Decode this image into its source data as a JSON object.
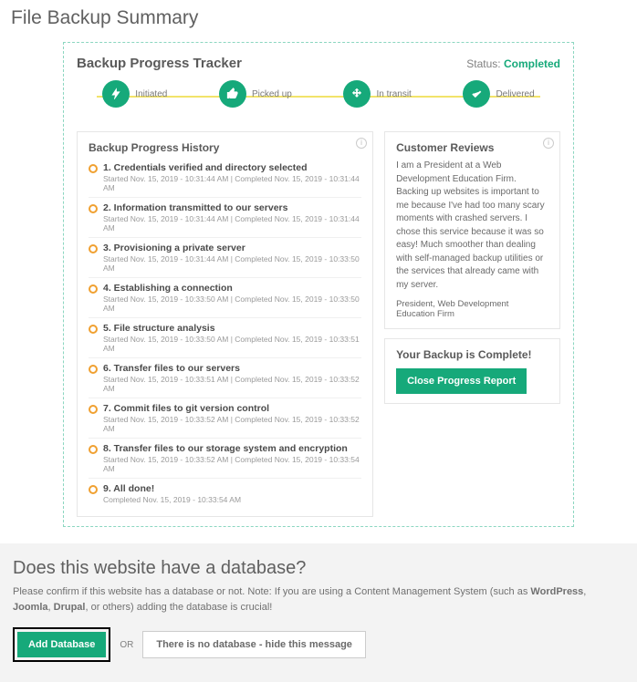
{
  "pageTitle": "File Backup Summary",
  "card": {
    "title": "Backup Progress Tracker",
    "statusLabel": "Status:",
    "statusValue": "Completed"
  },
  "tracker": [
    {
      "label": "Initiated"
    },
    {
      "label": "Picked up"
    },
    {
      "label": "In transit"
    },
    {
      "label": "Delivered"
    }
  ],
  "history": {
    "title": "Backup Progress History",
    "items": [
      {
        "title": "1. Credentials verified and directory selected",
        "started": "Started Nov. 15, 2019 - 10:31:44 AM",
        "completed": "Completed Nov. 15, 2019 - 10:31:44 AM"
      },
      {
        "title": "2. Information transmitted to our servers",
        "started": "Started Nov. 15, 2019 - 10:31:44 AM",
        "completed": "Completed Nov. 15, 2019 - 10:31:44 AM"
      },
      {
        "title": "3. Provisioning a private server",
        "started": "Started Nov. 15, 2019 - 10:31:44 AM",
        "completed": "Completed Nov. 15, 2019 - 10:33:50 AM"
      },
      {
        "title": "4. Establishing a connection",
        "started": "Started Nov. 15, 2019 - 10:33:50 AM",
        "completed": "Completed Nov. 15, 2019 - 10:33:50 AM"
      },
      {
        "title": "5. File structure analysis",
        "started": "Started Nov. 15, 2019 - 10:33:50 AM",
        "completed": "Completed Nov. 15, 2019 - 10:33:51 AM"
      },
      {
        "title": "6. Transfer files to our servers",
        "started": "Started Nov. 15, 2019 - 10:33:51 AM",
        "completed": "Completed Nov. 15, 2019 - 10:33:52 AM"
      },
      {
        "title": "7. Commit files to git version control",
        "started": "Started Nov. 15, 2019 - 10:33:52 AM",
        "completed": "Completed Nov. 15, 2019 - 10:33:52 AM"
      },
      {
        "title": "8. Transfer files to our storage system and encryption",
        "started": "Started Nov. 15, 2019 - 10:33:52 AM",
        "completed": "Completed Nov. 15, 2019 - 10:33:54 AM"
      },
      {
        "title": "9. All done!",
        "started": "",
        "completed": "Completed Nov. 15, 2019 - 10:33:54 AM"
      }
    ]
  },
  "reviews": {
    "title": "Customer Reviews",
    "body": "I am a President at a Web Development Education Firm. Backing up websites is important to me because I've had too many scary moments with crashed servers. I chose this service because it was so easy! Much smoother than dealing with self-managed backup utilities or the services that already came with my server.",
    "signature": "President, Web Development Education Firm"
  },
  "complete": {
    "title": "Your Backup is Complete!",
    "button": "Close Progress Report"
  },
  "db": {
    "heading": "Does this website have a database?",
    "descPrefix": "Please confirm if this website has a database or not. Note: If you are using a Content Management System (such as ",
    "cms1": "WordPress",
    "cms2": "Joomla",
    "cms3": "Drupal",
    "descSuffix": ", or others) adding the database is crucial!",
    "addBtn": "Add Database",
    "or": "OR",
    "hideBtn": "There is no database - hide this message"
  }
}
